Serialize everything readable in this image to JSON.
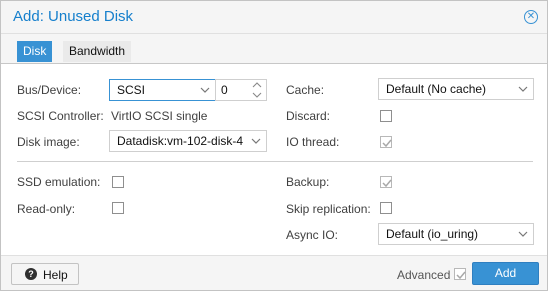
{
  "window": {
    "title": "Add: Unused Disk"
  },
  "tabs": [
    {
      "label": "Disk",
      "active": true
    },
    {
      "label": "Bandwidth",
      "active": false
    }
  ],
  "form": {
    "bus_device": {
      "label": "Bus/Device:",
      "bus": "SCSI",
      "device": "0"
    },
    "scsi_controller": {
      "label": "SCSI Controller:",
      "value": "VirtIO SCSI single"
    },
    "disk_image": {
      "label": "Disk image:",
      "value": "Datadisk:vm-102-disk-4"
    },
    "cache": {
      "label": "Cache:",
      "value": "Default (No cache)"
    },
    "discard": {
      "label": "Discard:",
      "checked": false
    },
    "io_thread": {
      "label": "IO thread:",
      "checked": true,
      "disabled": true
    },
    "ssd_emulation": {
      "label": "SSD emulation:",
      "checked": false
    },
    "read_only": {
      "label": "Read-only:",
      "checked": false
    },
    "backup": {
      "label": "Backup:",
      "checked": true,
      "disabled": true
    },
    "skip_replication": {
      "label": "Skip replication:",
      "checked": false
    },
    "async_io": {
      "label": "Async IO:",
      "value": "Default (io_uring)"
    }
  },
  "footer": {
    "help_label": "Help",
    "advanced_label": "Advanced",
    "advanced_checked": true,
    "add_label": "Add"
  },
  "colors": {
    "accent": "#3892d4",
    "title": "#157fcc"
  }
}
